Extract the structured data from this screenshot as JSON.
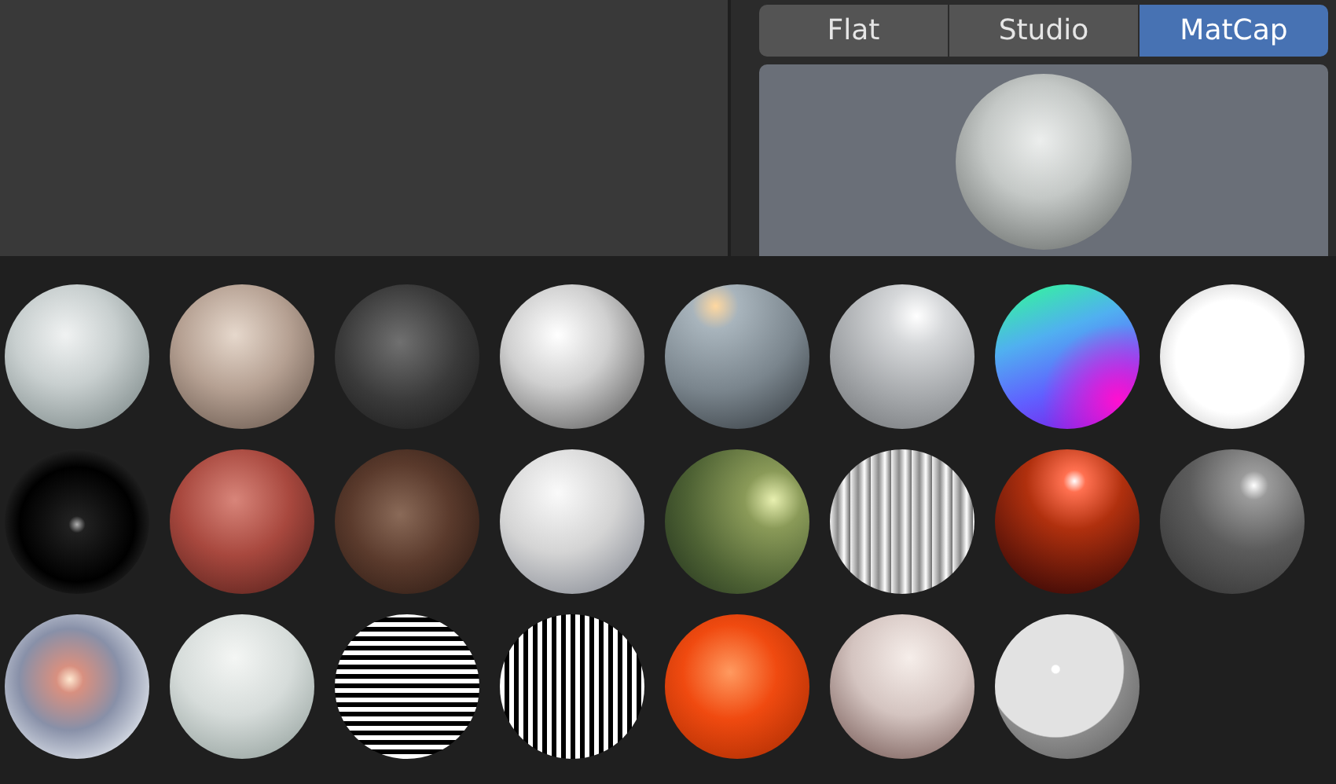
{
  "lighting_tabs": [
    {
      "label": "Flat",
      "selected": false
    },
    {
      "label": "Studio",
      "selected": false
    },
    {
      "label": "MatCap",
      "selected": true
    }
  ]
}
